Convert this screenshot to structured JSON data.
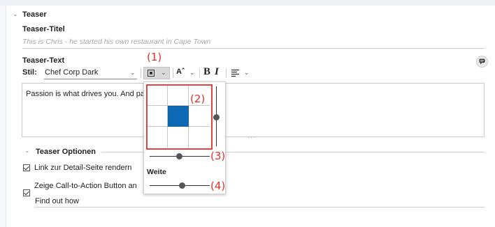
{
  "teaser": {
    "section_title": "Teaser",
    "title_label": "Teaser-Titel",
    "title_placeholder": "This is Chris - he started his own restaurant in Cape Town",
    "text_label": "Teaser-Text"
  },
  "toolbar": {
    "style_label": "Stil:",
    "style_value": "Chef Corp Dark",
    "font_size_icon_text": "Aˆ",
    "bold_label": "B",
    "italic_label": "I"
  },
  "editor": {
    "text": "Passion is what drives you. And pas"
  },
  "popup": {
    "weite_label": "Weite",
    "grid_selected_cell": 4
  },
  "annotations": {
    "a1": "(1)",
    "a2": "(2)",
    "a3": "(3)",
    "a4": "(4)"
  },
  "options": {
    "section_title": "Teaser Optionen",
    "checkbox1_label": "Link zur Detail-Seite rendern",
    "checkbox2_label": "Zeige Call-to-Action Button an",
    "cta_value": "Find out how"
  },
  "icons": {
    "collapse_chevron": "chevron-down-icon",
    "comment": "comment-icon",
    "align": "align-box-icon",
    "paragraph": "paragraph-align-icon"
  }
}
